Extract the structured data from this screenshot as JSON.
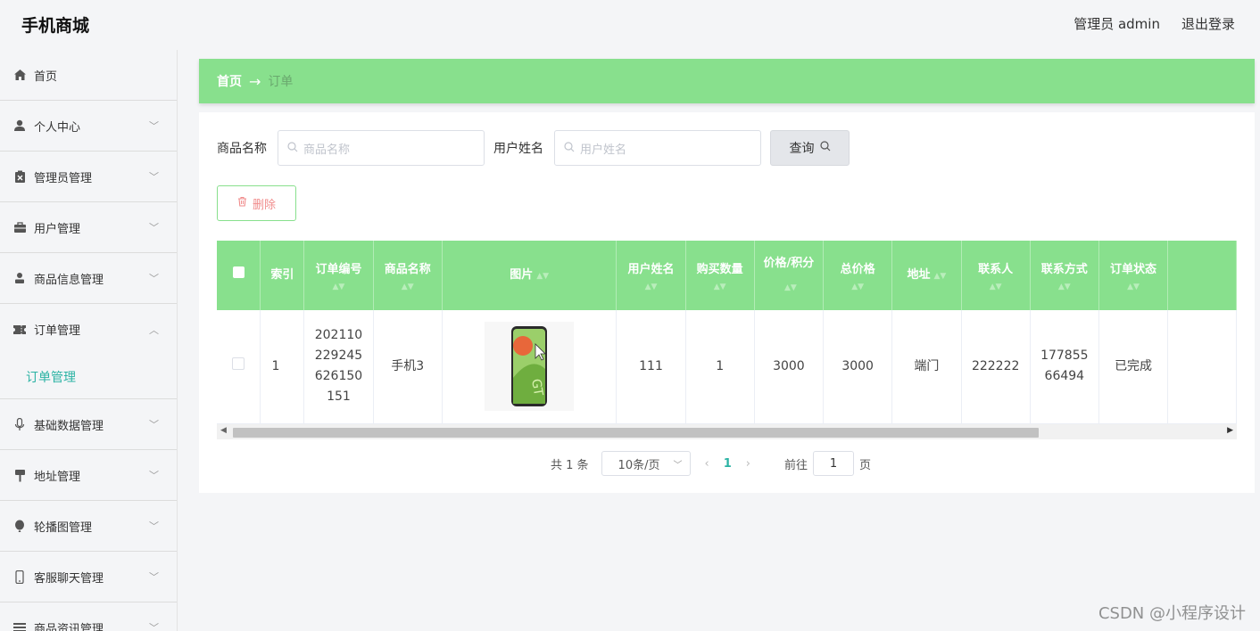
{
  "app": {
    "title": "手机商城"
  },
  "header": {
    "user": "管理员 admin",
    "logout": "退出登录"
  },
  "sidebar": {
    "items": [
      {
        "label": "首页",
        "icon": "home-icon"
      },
      {
        "label": "个人中心",
        "icon": "user-icon"
      },
      {
        "label": "管理员管理",
        "icon": "clipboard-icon"
      },
      {
        "label": "用户管理",
        "icon": "briefcase-icon"
      },
      {
        "label": "商品信息管理",
        "icon": "person-icon"
      },
      {
        "label": "订单管理",
        "icon": "ticket-icon",
        "expanded": true
      },
      {
        "label": "订单管理",
        "sub": true
      },
      {
        "label": "基础数据管理",
        "icon": "microphone-icon"
      },
      {
        "label": "地址管理",
        "icon": "signpost-icon"
      },
      {
        "label": "轮播图管理",
        "icon": "balloon-icon"
      },
      {
        "label": "客服聊天管理",
        "icon": "phone-icon"
      },
      {
        "label": "商品资讯管理",
        "icon": "list-icon"
      }
    ]
  },
  "breadcrumb": {
    "home": "首页",
    "sep": "→",
    "current": "订单"
  },
  "search": {
    "product_label": "商品名称",
    "product_placeholder": "商品名称",
    "user_label": "用户姓名",
    "user_placeholder": "用户姓名",
    "query_label": "查询"
  },
  "actions": {
    "delete_label": "删除"
  },
  "table": {
    "headers": [
      "索引",
      "订单编号",
      "商品名称",
      "图片",
      "用户姓名",
      "购买数量",
      "价格/积分",
      "总价格",
      "地址",
      "联系人",
      "联系方式",
      "订单状态"
    ],
    "rows": [
      {
        "index": "1",
        "order_no": "202110229245626150151",
        "product": "手机3",
        "user": "111",
        "qty": "1",
        "price": "3000",
        "total": "3000",
        "address": "端门",
        "contact": "222222",
        "phone": "17785566494",
        "status": "已完成"
      }
    ]
  },
  "pagination": {
    "total": "共 1 条",
    "page_size": "10条/页",
    "current_page": "1",
    "goto_label": "前往",
    "goto_value": "1",
    "page_suffix": "页"
  },
  "watermark": "CSDN @小程序设计",
  "colors": {
    "accent": "#88e08d",
    "active_text": "#2bb3a4",
    "delete_text": "#f08c8c"
  }
}
